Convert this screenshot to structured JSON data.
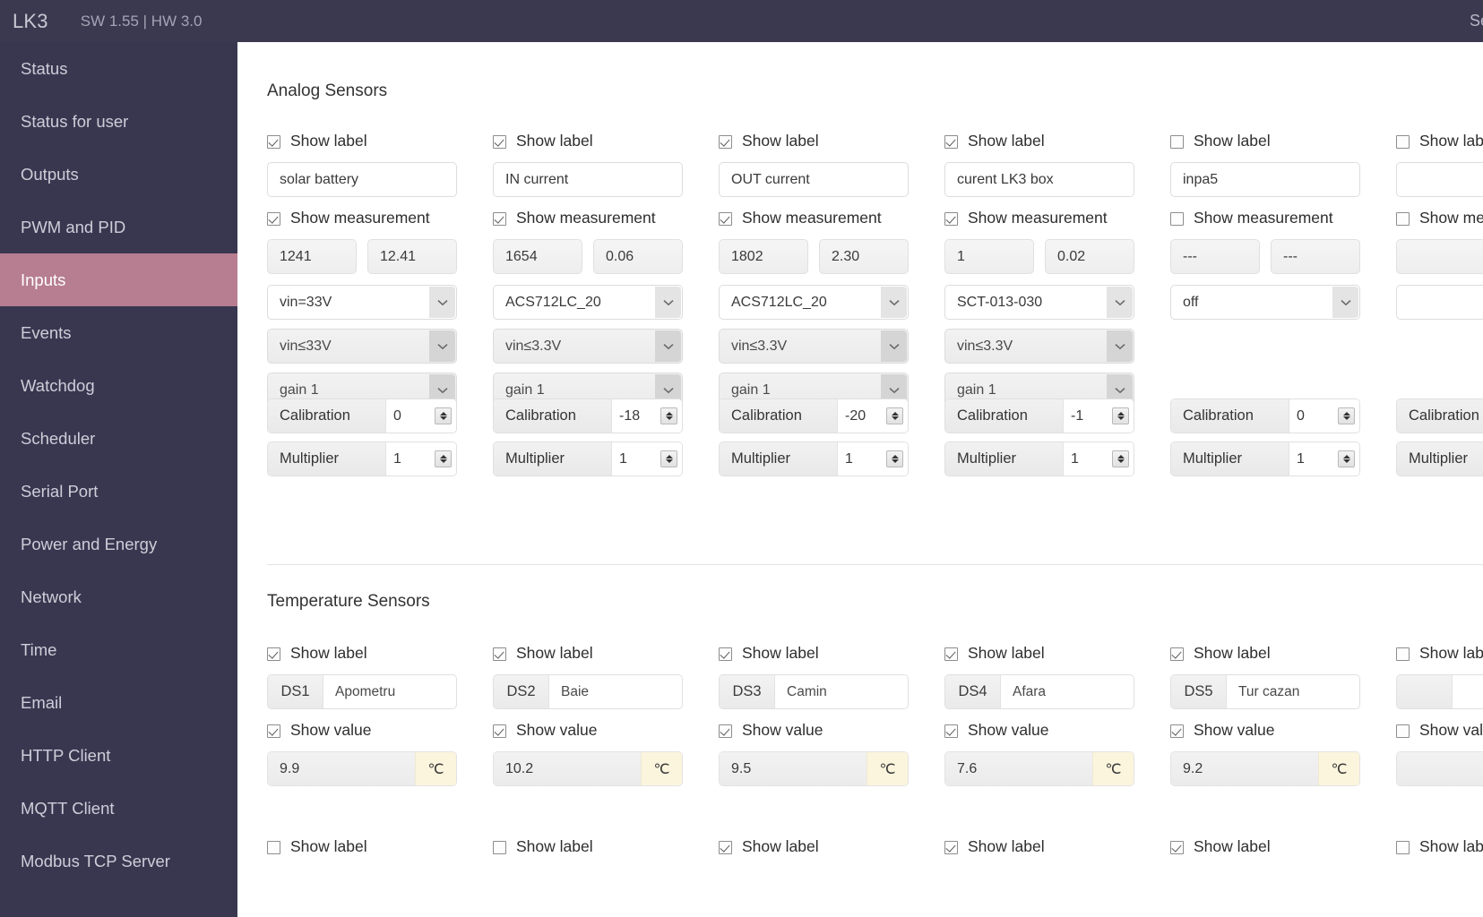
{
  "header": {
    "brand": "LK3",
    "firmware": "SW 1.55 | HW 3.0",
    "right_link": "Set"
  },
  "sidebar": {
    "items": [
      {
        "label": "Status",
        "active": false
      },
      {
        "label": "Status for user",
        "active": false
      },
      {
        "label": "Outputs",
        "active": false
      },
      {
        "label": "PWM and PID",
        "active": false
      },
      {
        "label": "Inputs",
        "active": true
      },
      {
        "label": "Events",
        "active": false
      },
      {
        "label": "Watchdog",
        "active": false
      },
      {
        "label": "Scheduler",
        "active": false
      },
      {
        "label": "Serial Port",
        "active": false
      },
      {
        "label": "Power and Energy",
        "active": false
      },
      {
        "label": "Network",
        "active": false
      },
      {
        "label": "Time",
        "active": false
      },
      {
        "label": "Email",
        "active": false
      },
      {
        "label": "HTTP Client",
        "active": false
      },
      {
        "label": "MQTT Client",
        "active": false
      },
      {
        "label": "Modbus TCP Server",
        "active": false
      }
    ]
  },
  "common_labels": {
    "show_label": "Show label",
    "show_measurement": "Show measurement",
    "show_value": "Show value",
    "calibration": "Calibration",
    "multiplier": "Multiplier"
  },
  "analog": {
    "title": "Analog Sensors",
    "channels": [
      {
        "show_label": true,
        "name": "solar battery",
        "show_measurement": true,
        "raw": "1241",
        "scaled": "12.41",
        "sensor_type": "vin=33V",
        "range": "vin≤33V",
        "gain": "gain 1",
        "calibration": "0",
        "multiplier": "1",
        "has_range": true,
        "has_gain": true
      },
      {
        "show_label": true,
        "name": "IN current",
        "show_measurement": true,
        "raw": "1654",
        "scaled": "0.06",
        "sensor_type": "ACS712LC_20",
        "range": "vin≤3.3V",
        "gain": "gain 1",
        "calibration": "-18",
        "multiplier": "1",
        "has_range": true,
        "has_gain": true
      },
      {
        "show_label": true,
        "name": "OUT current",
        "show_measurement": true,
        "raw": "1802",
        "scaled": "2.30",
        "sensor_type": "ACS712LC_20",
        "range": "vin≤3.3V",
        "gain": "gain 1",
        "calibration": "-20",
        "multiplier": "1",
        "has_range": true,
        "has_gain": true
      },
      {
        "show_label": true,
        "name": "curent LK3 box",
        "show_measurement": true,
        "raw": "1",
        "scaled": "0.02",
        "sensor_type": "SCT-013-030",
        "range": "vin≤3.3V",
        "gain": "gain 1",
        "calibration": "-1",
        "multiplier": "1",
        "has_range": true,
        "has_gain": true
      },
      {
        "show_label": false,
        "name": "inpa5",
        "show_measurement": false,
        "raw": "---",
        "scaled": "---",
        "sensor_type": "off",
        "range": "",
        "gain": "",
        "calibration": "0",
        "multiplier": "1",
        "has_range": false,
        "has_gain": false
      },
      {
        "show_label": false,
        "name": "",
        "show_measurement": false,
        "raw": "",
        "scaled": "",
        "sensor_type": "",
        "range": "",
        "gain": "",
        "calibration": "",
        "multiplier": "",
        "has_range": false,
        "has_gain": false
      }
    ]
  },
  "temperature": {
    "title": "Temperature Sensors",
    "unit": "℃",
    "channels": [
      {
        "show_label": true,
        "tag": "DS1",
        "name": "Apometru",
        "show_value": true,
        "value": "9.9"
      },
      {
        "show_label": true,
        "tag": "DS2",
        "name": "Baie",
        "show_value": true,
        "value": "10.2"
      },
      {
        "show_label": true,
        "tag": "DS3",
        "name": "Camin",
        "show_value": true,
        "value": "9.5"
      },
      {
        "show_label": true,
        "tag": "DS4",
        "name": "Afara",
        "show_value": true,
        "value": "7.6"
      },
      {
        "show_label": true,
        "tag": "DS5",
        "name": "Tur cazan",
        "show_value": true,
        "value": "9.2"
      },
      {
        "show_label": false,
        "tag": "",
        "name": "",
        "show_value": false,
        "value": ""
      }
    ],
    "second_row": [
      {
        "show_label": false
      },
      {
        "show_label": false
      },
      {
        "show_label": true
      },
      {
        "show_label": true
      },
      {
        "show_label": true
      },
      {
        "show_label": false
      }
    ]
  },
  "colors": {
    "sidebar_bg": "#393750",
    "topbar_bg": "#3b3950",
    "active_item": "#b77d91",
    "unit_badge": "#fbf5dd"
  }
}
